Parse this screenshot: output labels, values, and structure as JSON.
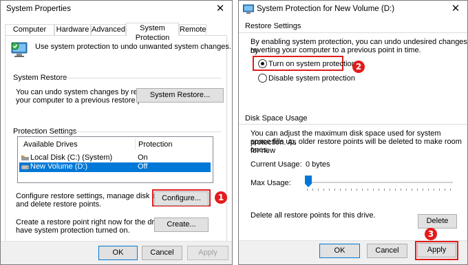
{
  "left_window": {
    "title": "System Properties",
    "close_glyph": "✕",
    "tabs": [
      "Computer Name",
      "Hardware",
      "Advanced",
      "System Protection",
      "Remote"
    ],
    "active_tab": "System Protection",
    "intro_text": "Use system protection to undo unwanted system changes.",
    "system_restore": {
      "heading": "System Restore",
      "description_line1": "You can undo system changes by reverting",
      "description_line2": "your computer to a previous restore point.",
      "button_label": "System Restore..."
    },
    "protection_settings": {
      "heading": "Protection Settings",
      "columns": [
        "Available Drives",
        "Protection"
      ],
      "rows": [
        {
          "drive": "Local Disk (C:) (System)",
          "protection": "On",
          "selected": false
        },
        {
          "drive": "New Volume (D:)",
          "protection": "Off",
          "selected": true
        }
      ],
      "configure_line1": "Configure restore settings, manage disk space,",
      "configure_line2": "and delete restore points.",
      "configure_label": "Configure...",
      "create_line1": "Create a restore point right now for the drives that",
      "create_line2": "have system protection turned on.",
      "create_label": "Create..."
    },
    "buttons": {
      "ok": "OK",
      "cancel": "Cancel",
      "apply": "Apply"
    },
    "step_badge": "1"
  },
  "right_window": {
    "title": "System Protection for New Volume (D:)",
    "close_glyph": "✕",
    "restore_settings": {
      "heading": "Restore Settings",
      "description_line1": "By enabling system protection, you can undo undesired changes by",
      "description_line2": "reverting your computer to a previous point in time.",
      "options": [
        {
          "label": "Turn on system protection",
          "checked": true
        },
        {
          "label": "Disable system protection",
          "checked": false
        }
      ],
      "step_badge": "2"
    },
    "disk_space": {
      "heading": "Disk Space Usage",
      "description_line1": "You can adjust the maximum disk space used for system protection. As",
      "description_line2": "space fills up, older restore points will be deleted to make room for new",
      "description_line3": "ones.",
      "current_usage_label": "Current Usage:",
      "current_usage_value": "0 bytes",
      "max_usage_label": "Max Usage:",
      "max_usage_level": 0.0
    },
    "delete": {
      "text": "Delete all restore points for this drive.",
      "button_label": "Delete"
    },
    "buttons": {
      "ok": "OK",
      "cancel": "Cancel",
      "apply": "Apply"
    },
    "step_badge": "3"
  },
  "colors": {
    "accent": "#0078d7",
    "annotation_red": "#e31b1b",
    "footer_bg": "#f0f0f0"
  }
}
